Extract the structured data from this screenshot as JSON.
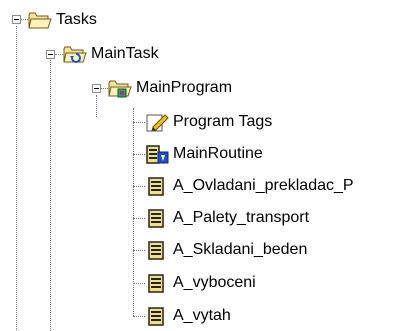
{
  "tree": {
    "root": {
      "label": "Tasks",
      "icon": "folder-icon"
    },
    "task": {
      "label": "MainTask",
      "icon": "task-folder-icon"
    },
    "program": {
      "label": "MainProgram",
      "icon": "program-folder-icon"
    },
    "children": [
      {
        "label": "Program Tags",
        "icon": "program-tags-icon"
      },
      {
        "label": "MainRoutine",
        "icon": "main-routine-icon"
      },
      {
        "label": "A_Ovladani_prekladac_P",
        "icon": "routine-icon"
      },
      {
        "label": "A_Palety_transport",
        "icon": "routine-icon"
      },
      {
        "label": "A_Skladani_beden",
        "icon": "routine-icon"
      },
      {
        "label": "A_vyboceni",
        "icon": "routine-icon"
      },
      {
        "label": "A_vytah",
        "icon": "routine-icon"
      }
    ]
  }
}
